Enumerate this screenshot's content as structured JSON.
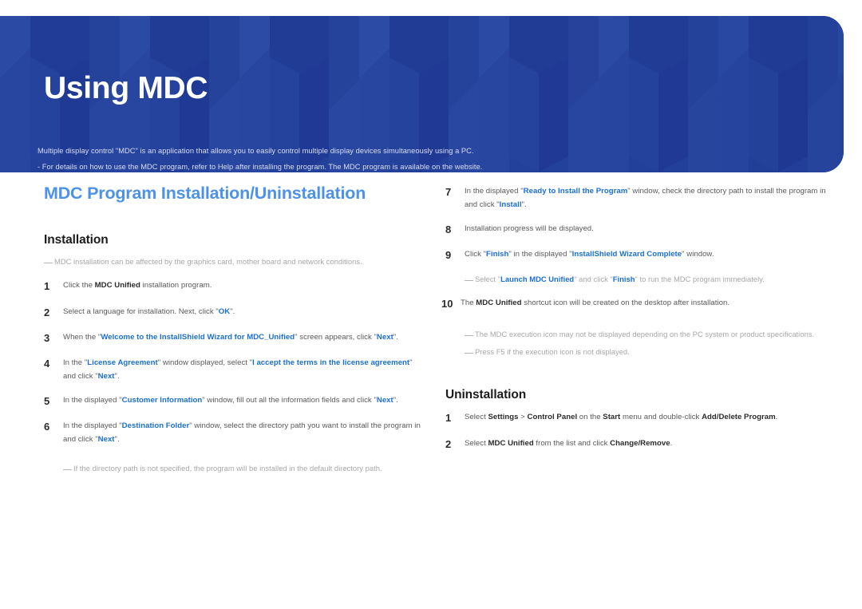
{
  "banner": {
    "title": "Using MDC",
    "description_lines": [
      "Multiple display control \"MDC\" is an application that allows you to easily control multiple display devices simultaneously using a PC.",
      "- For details on how to use the MDC program, refer to Help after installing the program. The MDC program is available on the website."
    ],
    "bg_color": "#23409a",
    "title_color": "#ffffff"
  },
  "colors": {
    "main_heading": "#4b92e8",
    "highlight": "#1a6fd4",
    "body_text": "#5a5a5a",
    "note_text": "#a8a8a8",
    "bold_text": "#2b2b2b"
  },
  "main_heading": "MDC Program Installation/Uninstallation",
  "installation": {
    "heading": "Installation",
    "intro_note": "MDC installation can be affected by the graphics card, mother board and network conditions.",
    "steps": [
      {
        "num": "1",
        "text": "Click the MDC Unified installation program."
      },
      {
        "num": "2",
        "text": "Select a language for installation. Next, click \"OK\"."
      },
      {
        "num": "3",
        "text": "When the \"Welcome to the InstallShield Wizard for MDC_Unified\" screen appears, click \"Next\"."
      },
      {
        "num": "4",
        "text": "In the \"License Agreement\" window displayed, select \"I accept the terms in the license agreement\" and click \"Next\"."
      },
      {
        "num": "5",
        "text": "In the displayed \"Customer Information\" window, fill out all the information fields and click \"Next\"."
      },
      {
        "num": "6",
        "text": "In the displayed \"Destination Folder\" window, select the directory path you want to install the program in and click \"Next\"."
      },
      {
        "num": "7",
        "text": "In the displayed \"Ready to Install the Program\" window, check the directory path to install the program in and click \"Install\"."
      },
      {
        "num": "8",
        "text": "Installation progress will be displayed."
      },
      {
        "num": "9",
        "text": "Click \"Finish\" in the displayed \"InstallShield Wizard Complete\" window."
      },
      {
        "num": "10",
        "text": "The MDC Unified shortcut icon will be created on the desktop after installation."
      }
    ],
    "note_step6": "If the directory path is not specified, the program will be installed in the default directory path.",
    "note_step9": "Select \"Launch MDC Unified\" and click \"Finish\" to run the MDC program immediately.",
    "note_step10_a": "The MDC execution icon may not be displayed depending on the PC system or product specifications.",
    "note_step10_b": "Press F5 if the execution icon is not displayed."
  },
  "uninstallation": {
    "heading": "Uninstallation",
    "steps": [
      {
        "num": "1",
        "text": "Select Settings > Control Panel on the Start menu and double-click Add/Delete Program."
      },
      {
        "num": "2",
        "text": "Select MDC Unified from the list and click Change/Remove."
      }
    ]
  }
}
